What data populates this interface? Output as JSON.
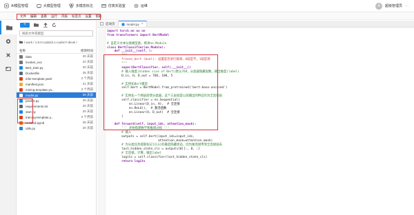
{
  "topbar": {
    "nav": [
      {
        "label": "AI模型管理",
        "icon": "ai-model-icon"
      },
      {
        "label": "大模型管理",
        "icon": "large-model-icon"
      },
      {
        "label": "多模态标注",
        "icon": "annotation-icon"
      },
      {
        "label": "仿真实验室",
        "icon": "lab-icon"
      },
      {
        "label": "运维",
        "icon": "ops-icon"
      }
    ],
    "user": {
      "avatar": "A",
      "name": "超级管理员",
      "more": "···"
    }
  },
  "menubar": {
    "items": [
      "文件",
      "编辑",
      "查看",
      "运行",
      "内核",
      "标签页",
      "设置",
      "帮助"
    ]
  },
  "rail": {
    "icons": [
      "folder-icon",
      "running-icon",
      "commands-icon",
      "tabs-icon"
    ]
  },
  "filepanel": {
    "new_button": "+",
    "search_placeholder": "搜索文件或模型",
    "path": "/ work / 1.8.0-cuda10.1-cudnn7-devel /",
    "col_name": "名称",
    "col_modified": "修改时间",
    "files": [
      {
        "name": "data",
        "date": "20 天前",
        "type": "folder"
      },
      {
        "name": "invoker_exc",
        "date": "22 天前",
        "type": "folder"
      },
      {
        "name": "Bert_train.py",
        "date": "20 天前",
        "type": "python"
      },
      {
        "name": "Dockerfile",
        "date": "25 天前",
        "type": "file"
      },
      {
        "name": "infer-template.yaml",
        "date": "2 个月前",
        "type": "yaml"
      },
      {
        "name": "manifest.json",
        "date": "21 天前",
        "type": "json"
      },
      {
        "name": "mining-template.ya...",
        "date": "2 个月前",
        "type": "yaml"
      },
      {
        "name": "model.py",
        "date": "20 天前",
        "type": "python",
        "selected": true
      },
      {
        "name": "predict.py",
        "date": "20 天前",
        "type": "python"
      },
      {
        "name": "requirements.txt",
        "date": "20 天前",
        "type": "text"
      },
      {
        "name": "start.py",
        "date": "20 天前",
        "type": "python"
      },
      {
        "name": "training-template.y...",
        "date": "2 个月前",
        "type": "yaml"
      },
      {
        "name": "Untitled.ipynb",
        "date": "25 天前",
        "type": "notebook"
      },
      {
        "name": "utils.py",
        "date": "20 天前",
        "type": "python"
      }
    ]
  },
  "tabs": [
    {
      "label": "启动页",
      "active": false
    },
    {
      "label": "model.py",
      "active": true
    }
  ],
  "editor": {
    "lines": [
      "import torch.nn as nn",
      "from transformers import BertModel",
      "",
      "# 自定义文本分类模型类，继承nn.Module",
      "class BertClassifier(nn.Module):",
      "    def __init__(self, ):",
      "        \"\"\"",
      "        freeze_bert (bool): 设置是否进行微调，0就是不，1就是调",
      "        \"\"\"",
      "        super(BertClassifier, self).__init__()",
      "        # 输入维度(hidden size of Bert)默认768，分类器隐藏层数，输出维度(label)",
      "        D_in, H, D_out = 768, 100, 5",
      "",
      "        # 实例化Bert模型",
      "        self.bert = BertModel.from_pretrained('bert-base-uncased')",
      "",
      "        # 实例化一个两层前馈分类器，这个三层就是以前输出的特征作为全连接层",
      "        self.classifier = nn.Sequential(",
      "            nn.Linear(D_in, H),  # 全连接",
      "            nn.ReLU(),  # 激活函数",
      "            nn.Linear(H, D_out)  # 全连接",
      "        )",
      "",
      "    def forward(self, input_ids, attention_mask):",
      "        ''' 开始搭建数学和推理过程 '''",
      "        # 输入",
      "        outputs = self.bert(input_ids=input_ids,",
      "                            attention_mask=attention_mask)",
      "        # 为分类任务提取标记[CLS]的最后隐藏状态，因为要连接传到全连接层去",
      "        last_hidden_state_cls = outputs[0][:, 0, :]",
      "        # 全连接，计算，输出label",
      "        logits = self.classifier(last_hidden_state_cls)",
      "        return logits"
    ]
  },
  "colors": {
    "accent": "#1e88e5",
    "highlight_box": "#d9363e",
    "selection": "#2e7bd6"
  }
}
